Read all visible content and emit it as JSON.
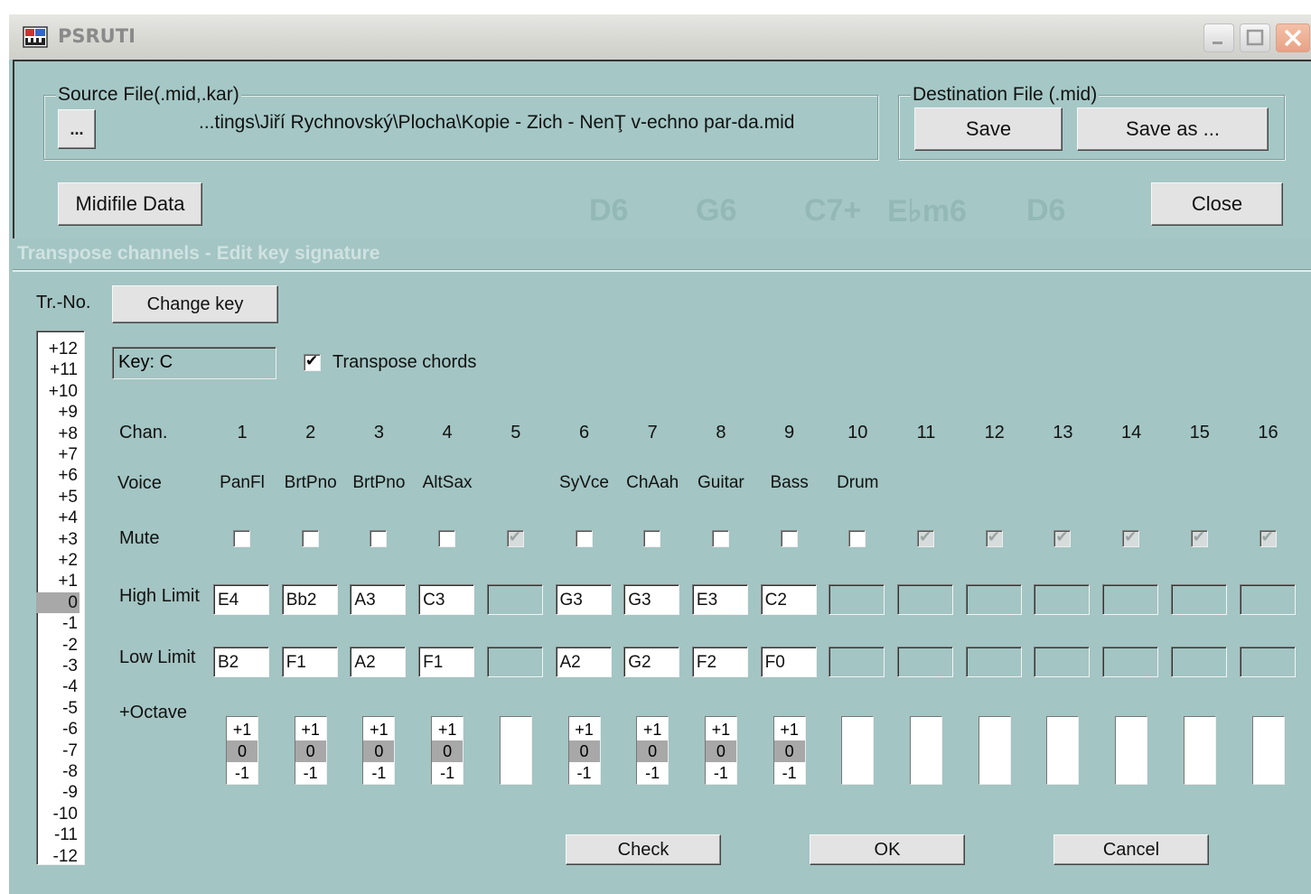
{
  "window": {
    "title": "PSRUTI"
  },
  "source": {
    "group_label": "Source File(.mid,.kar)",
    "browse_label": "...",
    "path": "...tings\\Jiří Rychnovský\\Plocha\\Kopie - Zich - NenŢ v-echno par-da.mid"
  },
  "destination": {
    "group_label": "Destination File (.mid)",
    "save_label": "Save",
    "save_as_label": "Save as ..."
  },
  "midifile_label": "Midifile Data",
  "close_label": "Close",
  "chords": [
    "D6",
    "G6",
    "C7+",
    "E♭m6",
    "D6"
  ],
  "section_title": "Transpose channels - Edit key signature",
  "trno": {
    "label": "Tr.-No.",
    "items": [
      "+12",
      "+11",
      "+10",
      "+9",
      "+8",
      "+7",
      "+6",
      "+5",
      "+4",
      "+3",
      "+2",
      "+1",
      "0",
      "-1",
      "-2",
      "-3",
      "-4",
      "-5",
      "-6",
      "-7",
      "-8",
      "-9",
      "-10",
      "-11",
      "-12"
    ],
    "selected": "0"
  },
  "change_key_label": "Change key",
  "key_text": "Key:  C",
  "transpose_chords": {
    "label": "Transpose chords",
    "checked": true
  },
  "row_labels": {
    "chan": "Chan.",
    "voice": "Voice",
    "mute": "Mute",
    "high": "High Limit",
    "low": "Low Limit",
    "octave": "+Octave"
  },
  "channels": [
    {
      "num": "1",
      "voice": "PanFl",
      "mute": false,
      "high": "E4",
      "low": "B2",
      "octave": true
    },
    {
      "num": "2",
      "voice": "BrtPno",
      "mute": false,
      "high": "Bb2",
      "low": "F1",
      "octave": true
    },
    {
      "num": "3",
      "voice": "BrtPno",
      "mute": false,
      "high": "A3",
      "low": "A2",
      "octave": true
    },
    {
      "num": "4",
      "voice": "AltSax",
      "mute": false,
      "high": "C3",
      "low": "F1",
      "octave": true
    },
    {
      "num": "5",
      "voice": "",
      "mute": true,
      "high": "",
      "low": "",
      "octave": false
    },
    {
      "num": "6",
      "voice": "SyVce",
      "mute": false,
      "high": "G3",
      "low": "A2",
      "octave": true
    },
    {
      "num": "7",
      "voice": "ChAah",
      "mute": false,
      "high": "G3",
      "low": "G2",
      "octave": true
    },
    {
      "num": "8",
      "voice": "Guitar",
      "mute": false,
      "high": "E3",
      "low": "F2",
      "octave": true
    },
    {
      "num": "9",
      "voice": "Bass",
      "mute": false,
      "high": "C2",
      "low": "F0",
      "octave": true
    },
    {
      "num": "10",
      "voice": "Drum",
      "mute": false,
      "high": "",
      "low": "",
      "octave": false
    },
    {
      "num": "11",
      "voice": "",
      "mute": true,
      "high": "",
      "low": "",
      "octave": false
    },
    {
      "num": "12",
      "voice": "",
      "mute": true,
      "high": "",
      "low": "",
      "octave": false
    },
    {
      "num": "13",
      "voice": "",
      "mute": true,
      "high": "",
      "low": "",
      "octave": false
    },
    {
      "num": "14",
      "voice": "",
      "mute": true,
      "high": "",
      "low": "",
      "octave": false
    },
    {
      "num": "15",
      "voice": "",
      "mute": true,
      "high": "",
      "low": "",
      "octave": false
    },
    {
      "num": "16",
      "voice": "",
      "mute": true,
      "high": "",
      "low": "",
      "octave": false
    }
  ],
  "octave_options": [
    "+1",
    "0",
    "-1"
  ],
  "buttons": {
    "check": "Check",
    "ok": "OK",
    "cancel": "Cancel"
  }
}
